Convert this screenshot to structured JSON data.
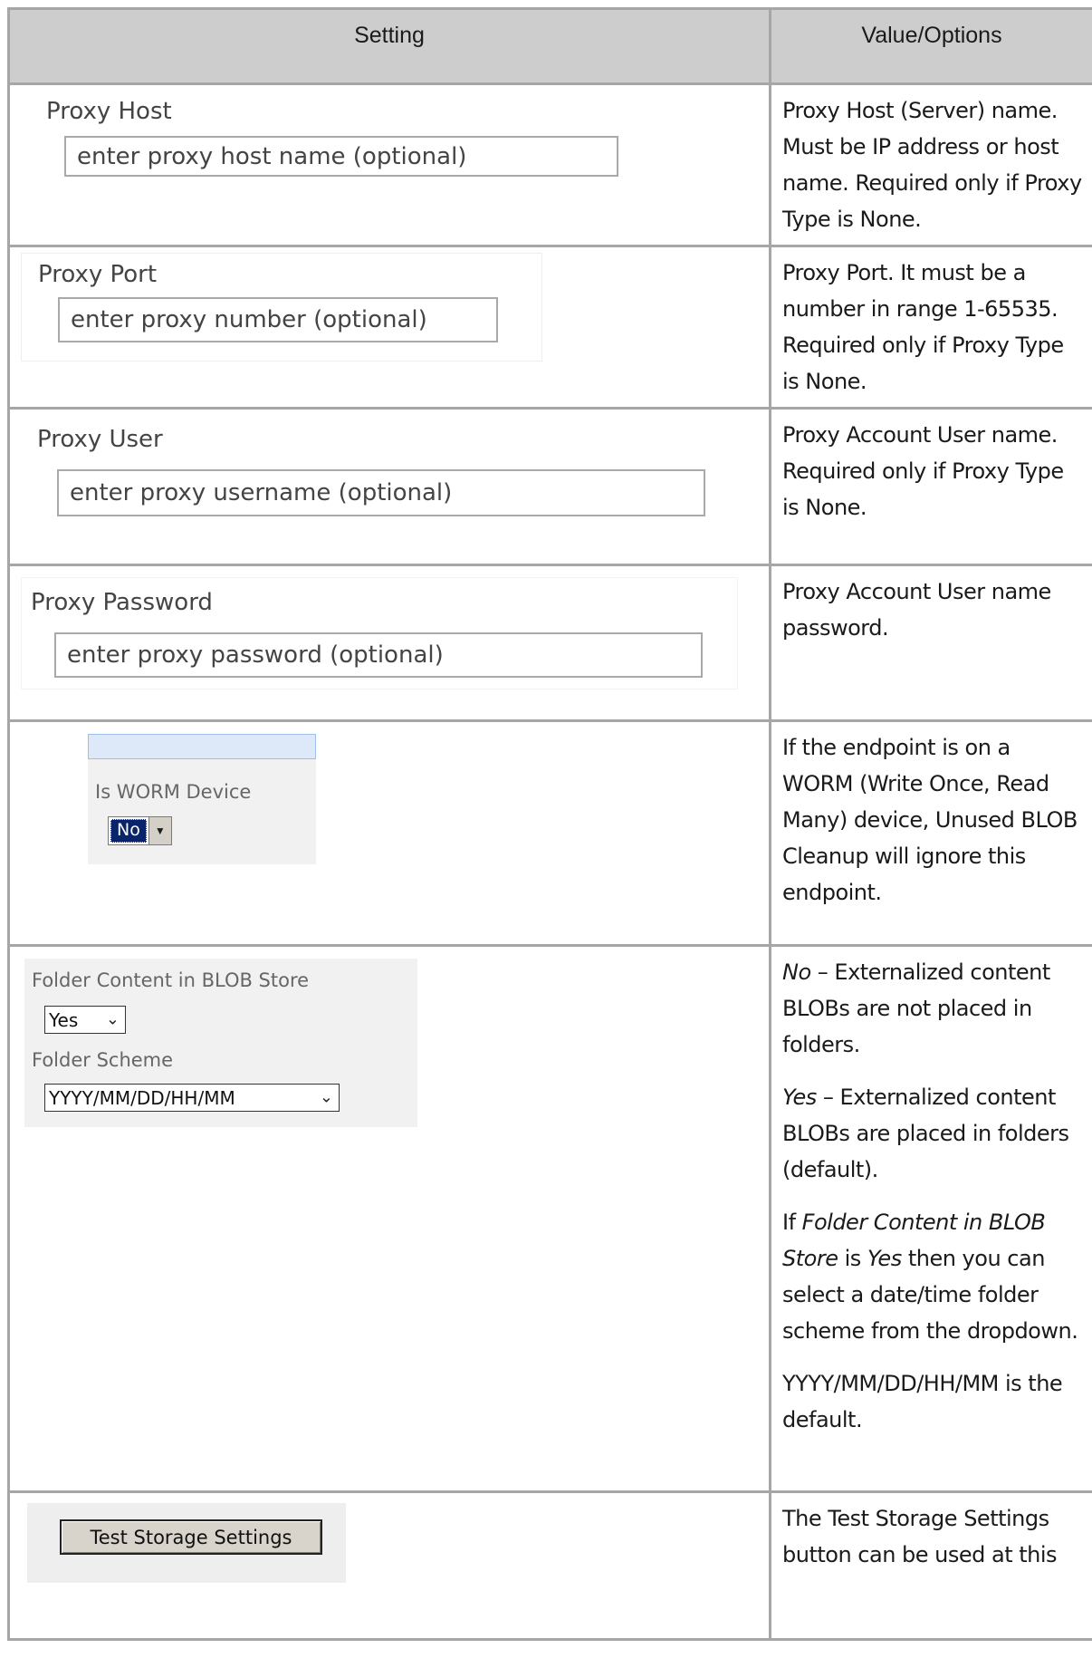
{
  "table": {
    "headers": {
      "setting": "Setting",
      "value": "Value/Options"
    }
  },
  "rows": {
    "proxy_host": {
      "label": "Proxy Host",
      "placeholder": "enter proxy host name (optional)",
      "description": "Proxy Host (Server) name. Must be IP address or host name. Required only if Proxy Type is None."
    },
    "proxy_port": {
      "label": "Proxy Port",
      "placeholder": "enter proxy number (optional)",
      "description": "Proxy Port. It must be a number in range 1-65535. Required only if Proxy Type is None."
    },
    "proxy_user": {
      "label": "Proxy User",
      "placeholder": "enter proxy username (optional)",
      "description": "Proxy Account User name. Required only if Proxy Type is None."
    },
    "proxy_password": {
      "label": "Proxy Password",
      "placeholder": "enter proxy password (optional)",
      "description": "Proxy Account User name password."
    },
    "worm": {
      "label": "Is WORM Device",
      "selected": "No",
      "description": "If the endpoint is on a WORM (Write Once, Read Many) device, Unused BLOB Cleanup will ignore this endpoint."
    },
    "folder": {
      "content_label": "Folder Content in BLOB Store",
      "content_selected": "Yes",
      "scheme_label": "Folder Scheme",
      "scheme_selected": "YYYY/MM/DD/HH/MM",
      "desc_no_term": "No",
      "desc_no_text": " – Externalized content BLOBs are not placed in folders.",
      "desc_yes_term": "Yes",
      "desc_yes_text": " – Externalized content BLOBs are placed in folders (default).",
      "desc_if_prefix": "If ",
      "desc_if_term": "Folder Content in BLOB Store",
      "desc_if_mid": " is ",
      "desc_if_yes": "Yes",
      "desc_if_suffix": " then you can select a date/time folder scheme from the dropdown.",
      "desc_default": "YYYY/MM/DD/HH/MM is the default."
    },
    "test": {
      "button_label": "Test Storage Settings",
      "description": "The Test Storage Settings button can be used at this"
    }
  }
}
